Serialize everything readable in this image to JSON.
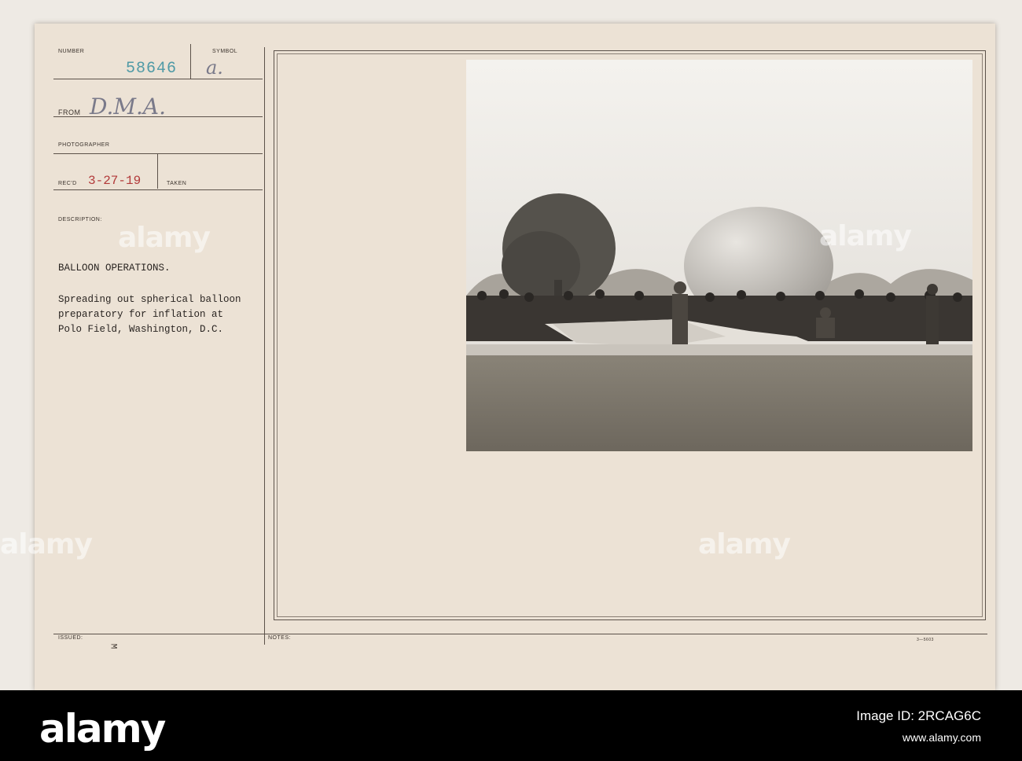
{
  "record": {
    "number_label": "NUMBER",
    "number": "58646",
    "symbol_label": "SYMBOL",
    "symbol": "a.",
    "from_label": "FROM",
    "from": "D.M.A.",
    "photographer_label": "PHOTOGRAPHER",
    "recd_label": "REC'D",
    "recd": "3-27-19",
    "taken_label": "TAKEN",
    "description_label": "DESCRIPTION:",
    "title": "BALLOON OPERATIONS.",
    "caption_lines": [
      "Spreading out spherical balloon",
      "preparatory for inflation at",
      "Polo Field, Washington, D.C."
    ],
    "issued_label": "ISSUED:",
    "issued_mark": "M",
    "notes_label": "NOTES:",
    "form_number": "3—5603"
  },
  "watermark": {
    "text": "alamy"
  },
  "footer": {
    "logo": "alamy",
    "image_id": "Image ID: 2RCAG6C",
    "url": "www.alamy.com"
  },
  "colors": {
    "card": "#ece2d5",
    "stamp_blue": "#4f9aa6",
    "stamp_red": "#b23a3a",
    "footer": "#000000"
  }
}
